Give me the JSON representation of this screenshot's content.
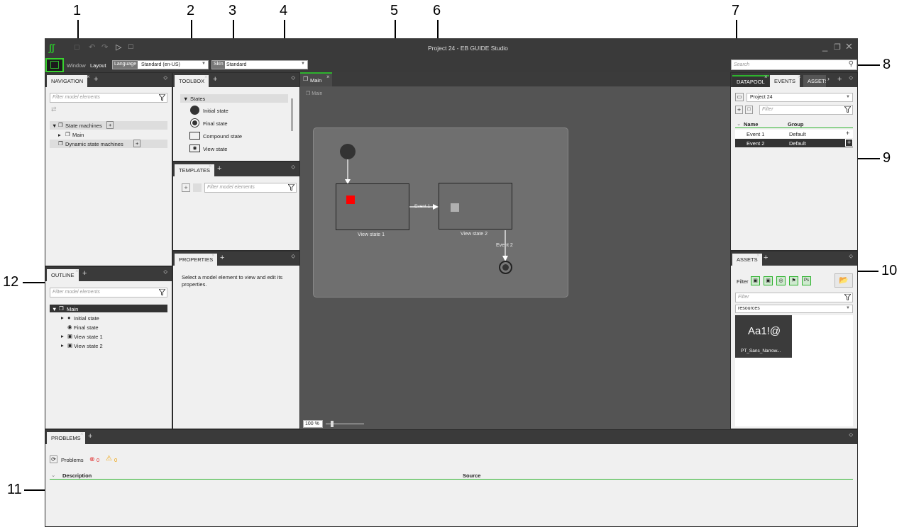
{
  "callouts": [
    "1",
    "2",
    "3",
    "4",
    "5",
    "6",
    "7",
    "8",
    "9",
    "10",
    "11",
    "12"
  ],
  "window": {
    "title": "Project 24 - EB GUIDE Studio"
  },
  "menu": {
    "window": "Window",
    "layout": "Layout",
    "language_label": "Language",
    "language_value": "Standard (en-US)",
    "skin_label": "Skin",
    "skin_value": "Standard"
  },
  "search": {
    "placeholder": "Search"
  },
  "navigation": {
    "tab": "NAVIGATION",
    "filter_placeholder": "Filter model elements",
    "state_machines": "State machines",
    "main": "Main",
    "dynamic": "Dynamic state machines"
  },
  "toolbox": {
    "tab": "TOOLBOX",
    "group": "States",
    "items": [
      "Initial state",
      "Final state",
      "Compound state",
      "View state"
    ]
  },
  "templates": {
    "tab": "TEMPLATES",
    "filter_placeholder": "Filter model elements"
  },
  "properties": {
    "tab": "PROPERTIES",
    "hint": "Select a model element to view and edit its properties."
  },
  "outline": {
    "tab": "OUTLINE",
    "filter_placeholder": "Filter model elements",
    "root": "Main",
    "items": [
      "Initial state",
      "Final state",
      "View state 1",
      "View state 2"
    ]
  },
  "editor": {
    "tab": "Main",
    "breadcrumb": "Main",
    "view_state_1": "View state 1",
    "view_state_2": "View state 2",
    "event_1": "Event 1",
    "event_2": "Event 2",
    "zoom": "100 %"
  },
  "datapool": {
    "tabs": [
      "DATAPOOL",
      "EVENTS",
      "ASSETS"
    ],
    "project": "Project 24",
    "filter_placeholder": "Filter",
    "col_name": "Name",
    "col_group": "Group",
    "rows": [
      {
        "name": "Event 1",
        "group": "Default"
      },
      {
        "name": "Event 2",
        "group": "Default"
      }
    ]
  },
  "assets": {
    "tab": "ASSETS",
    "filter_label": "Filter",
    "filter_placeholder": "Filter",
    "folder": "resources",
    "font_preview": "Aa1!@",
    "font_name": "PT_Sans_Narrow..."
  },
  "problems": {
    "tab": "PROBLEMS",
    "label": "Problems",
    "errors": "0",
    "warnings": "0",
    "col_desc": "Description",
    "col_source": "Source"
  },
  "colors": {
    "accent_green": "#2db32d",
    "error": "#e03030",
    "warning": "#f0a000"
  }
}
